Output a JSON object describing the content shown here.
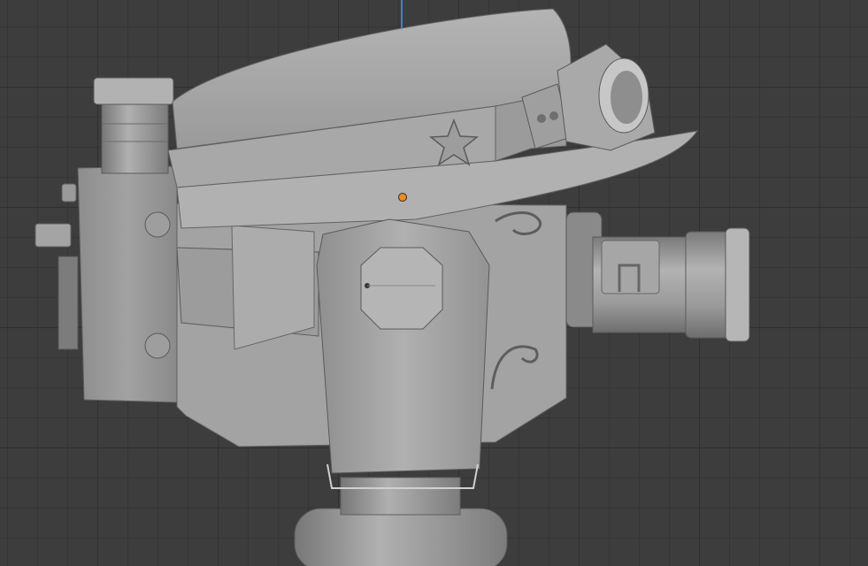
{
  "viewport": {
    "mode": "3d-viewport",
    "object": "camera-with-hat",
    "colors": {
      "background": "#3d3d3d",
      "grid_minor": "#353535",
      "grid_major": "#2f2f2f",
      "z_axis": "#3d7fd6",
      "object_origin": "#f08a1e",
      "mesh_light": "#a9a9a9",
      "mesh_mid": "#8f8f8f",
      "mesh_dark": "#6c6c6c"
    },
    "icons": [
      "star-icon"
    ]
  }
}
